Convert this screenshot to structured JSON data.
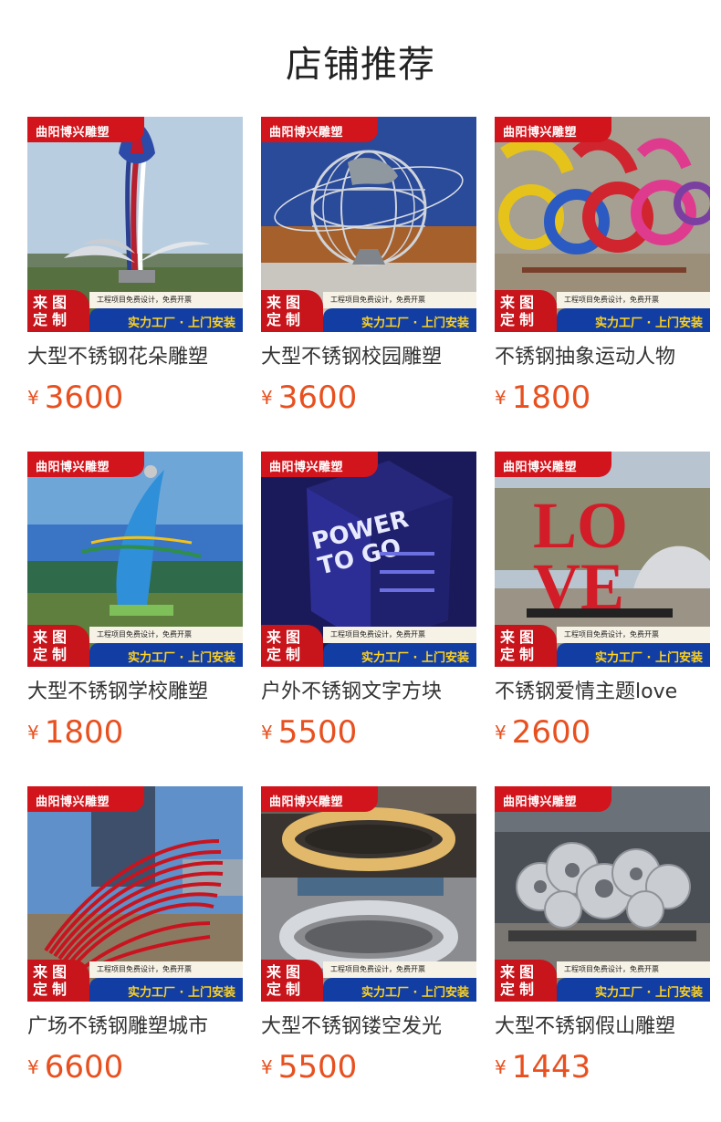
{
  "header": {
    "title": "店铺推荐"
  },
  "banner": {
    "brand": "曲阳博兴雕塑",
    "custom_line1": "来图",
    "custom_line2": "定制",
    "note": "工程项目免费设计，免费开票",
    "factory": "实力工厂 · 上门安装"
  },
  "products": [
    {
      "name": "大型不锈钢花朵雕塑",
      "currency": "¥",
      "price": "3600"
    },
    {
      "name": "大型不锈钢校园雕塑",
      "currency": "¥",
      "price": "3600"
    },
    {
      "name": "不锈钢抽象运动人物",
      "currency": "¥",
      "price": "1800"
    },
    {
      "name": "大型不锈钢学校雕塑",
      "currency": "¥",
      "price": "1800"
    },
    {
      "name": "户外不锈钢文字方块",
      "currency": "¥",
      "price": "5500"
    },
    {
      "name": "不锈钢爱情主题love",
      "currency": "¥",
      "price": "2600"
    },
    {
      "name": "广场不锈钢雕塑城市",
      "currency": "¥",
      "price": "6600"
    },
    {
      "name": "大型不锈钢镂空发光",
      "currency": "¥",
      "price": "5500"
    },
    {
      "name": "大型不锈钢假山雕塑",
      "currency": "¥",
      "price": "1443"
    }
  ],
  "photo_texts": {
    "cube_lines": [
      "POWER",
      "TO GO"
    ],
    "love_letters": [
      "LO",
      "VE"
    ]
  }
}
